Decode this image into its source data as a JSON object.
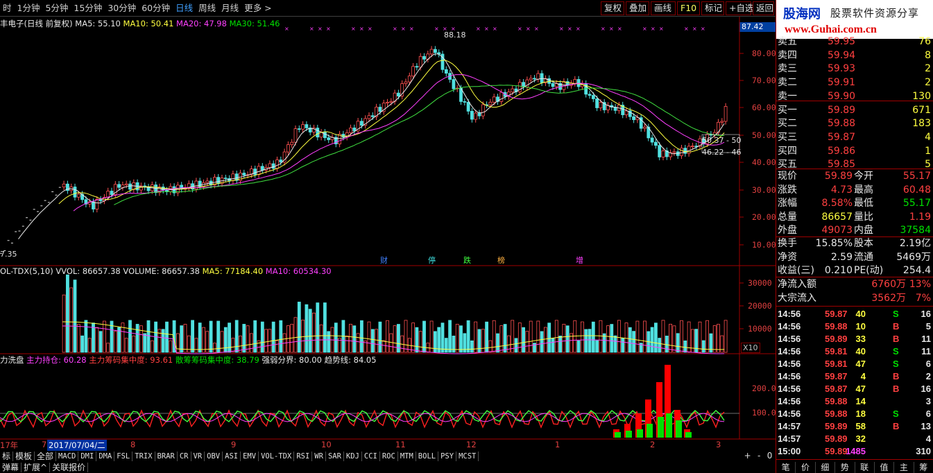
{
  "toolbar": {
    "periods": [
      "时",
      "1分钟",
      "5分钟",
      "15分钟",
      "30分钟",
      "60分钟",
      "日线",
      "周线",
      "月线",
      "更多 >"
    ],
    "active": "日线",
    "buttons": [
      "复权",
      "叠加",
      "画线",
      "F10",
      "标记",
      "+自选",
      "返回"
    ]
  },
  "main_legend": {
    "name": "丰电子(日线 前复权)",
    "ma5": "MA5: 55.10",
    "ma10": "MA10: 50.41",
    "ma20": "MA20: 47.98",
    "ma30": "MA30: 51.46",
    "cur_price": "87.42",
    "high_label": "88.18",
    "low_label": "7.35",
    "box_label1": "50.37 - 50",
    "box_label2": "46.22 - 46",
    "events": [
      "财",
      "停",
      "跌",
      "榜",
      "增"
    ]
  },
  "price_axis": [
    "80.00",
    "70.00",
    "60.00",
    "50.00",
    "40.00",
    "30.00",
    "20.00",
    "10.00"
  ],
  "vol_legend": {
    "name": "OL-TDX(5,10)",
    "vvol": "VVOL: 86657.38",
    "volume": "VOLUME: 86657.38",
    "ma5": "MA5: 77184.40",
    "ma10": "MA10: 60534.30",
    "x10": "X10"
  },
  "vol_axis": [
    "30000",
    "20000",
    "10000"
  ],
  "ind_legend": {
    "name": "力洗盘",
    "a": "主力持仓: 60.28",
    "b": "主力筹码集中度: 93.61",
    "c": "散筹筹码集中度: 38.79",
    "d": "强弱分界: 80.00",
    "e": "趋势线: 84.05"
  },
  "ind_axis": [
    "200.0",
    "100.0"
  ],
  "dates": [
    "17年",
    "7",
    "2017/07/04/二",
    "8",
    "9",
    "10",
    "11",
    "12",
    "1",
    "2",
    "3"
  ],
  "bottom_tabs": [
    "标",
    "模板",
    "全部",
    "MACD",
    "DMI",
    "DMA",
    "FSL",
    "TRIX",
    "BRAR",
    "CR",
    "VR",
    "OBV",
    "ASI",
    "EMV",
    "VOL-TDX",
    "RSI",
    "WR",
    "SAR",
    "KDJ",
    "CCI",
    "ROC",
    "MTM",
    "BOLL",
    "PSY",
    "MCST"
  ],
  "bottom_ctrl": [
    "+",
    "-",
    "0"
  ],
  "status_tabs": [
    "弹幕",
    "扩展^",
    "关联报价"
  ],
  "logo": {
    "t1": "股海网",
    "t2": "股票软件资源分享",
    "t3": "www.Guhai.com.cn"
  },
  "orderbook": [
    {
      "label": "卖五",
      "price": "59.95",
      "vol": "76"
    },
    {
      "label": "卖四",
      "price": "59.94",
      "vol": "8"
    },
    {
      "label": "卖三",
      "price": "59.93",
      "vol": "2"
    },
    {
      "label": "卖二",
      "price": "59.91",
      "vol": "2"
    },
    {
      "label": "卖一",
      "price": "59.90",
      "vol": "130"
    },
    {
      "label": "买一",
      "price": "59.89",
      "vol": "671"
    },
    {
      "label": "买二",
      "price": "59.88",
      "vol": "183"
    },
    {
      "label": "买三",
      "price": "59.87",
      "vol": "4"
    },
    {
      "label": "买四",
      "price": "59.86",
      "vol": "1"
    },
    {
      "label": "买五",
      "price": "59.85",
      "vol": "5"
    }
  ],
  "quote": [
    {
      "l1": "现价",
      "v1": "59.89",
      "l2": "今开",
      "v2": "55.17"
    },
    {
      "l1": "涨跌",
      "v1": "4.73",
      "l2": "最高",
      "v2": "60.48"
    },
    {
      "l1": "涨幅",
      "v1": "8.58%",
      "l2": "最低",
      "v2": "55.17"
    },
    {
      "l1": "总量",
      "v1": "86657",
      "l2": "量比",
      "v2": "1.19"
    },
    {
      "l1": "外盘",
      "v1": "49073",
      "l2": "内盘",
      "v2": "37584"
    }
  ],
  "stats": [
    {
      "l1": "换手",
      "v1": "15.85%",
      "l2": "股本",
      "v2": "2.19亿"
    },
    {
      "l1": "净资",
      "v1": "2.59",
      "l2": "流通",
      "v2": "5469万"
    },
    {
      "l1": "收益(三)",
      "v1": "0.210",
      "l2": "PE(动)",
      "v2": "254.4"
    }
  ],
  "flow": [
    {
      "label": "净流入额",
      "val": "6760万",
      "pct": "13%"
    },
    {
      "label": "大宗流入",
      "val": "3562万",
      "pct": "7%"
    }
  ],
  "ticks": [
    {
      "t": "14:56",
      "p": "59.87",
      "v": "40",
      "d": "S",
      "n": "16"
    },
    {
      "t": "14:56",
      "p": "59.88",
      "v": "10",
      "d": "B",
      "n": "5"
    },
    {
      "t": "14:56",
      "p": "59.89",
      "v": "33",
      "d": "B",
      "n": "11"
    },
    {
      "t": "14:56",
      "p": "59.81",
      "v": "40",
      "d": "S",
      "n": "11"
    },
    {
      "t": "14:56",
      "p": "59.81",
      "v": "47",
      "d": "S",
      "n": "6"
    },
    {
      "t": "14:56",
      "p": "59.87",
      "v": "4",
      "d": "B",
      "n": "2"
    },
    {
      "t": "14:56",
      "p": "59.87",
      "v": "47",
      "d": "B",
      "n": "16"
    },
    {
      "t": "14:56",
      "p": "59.88",
      "v": "14",
      "d": "",
      "n": "3"
    },
    {
      "t": "14:56",
      "p": "59.88",
      "v": "18",
      "d": "S",
      "n": "6"
    },
    {
      "t": "14:57",
      "p": "59.89",
      "v": "58",
      "d": "B",
      "n": "13"
    },
    {
      "t": "14:57",
      "p": "59.89",
      "v": "32",
      "d": "",
      "n": "4"
    },
    {
      "t": "15:00",
      "p": "59.89",
      "v": "1485",
      "d": "",
      "n": "310"
    }
  ],
  "right_tabs": [
    "笔",
    "价",
    "细",
    "势",
    "联",
    "值",
    "主",
    "筹"
  ]
}
